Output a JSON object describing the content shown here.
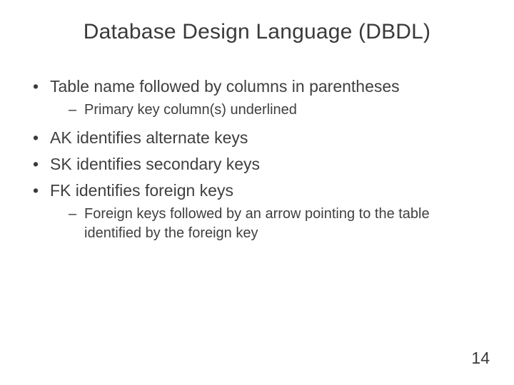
{
  "title": "Database Design Language (DBDL)",
  "bullets": [
    {
      "text": "Table name followed by columns in parentheses",
      "sub": [
        "Primary key column(s) underlined"
      ]
    },
    {
      "text": "AK identifies alternate keys"
    },
    {
      "text": "SK identifies secondary keys"
    },
    {
      "text": "FK identifies foreign keys",
      "sub": [
        "Foreign keys followed by an arrow pointing to the table identified by the foreign key"
      ]
    }
  ],
  "page_number": "14"
}
